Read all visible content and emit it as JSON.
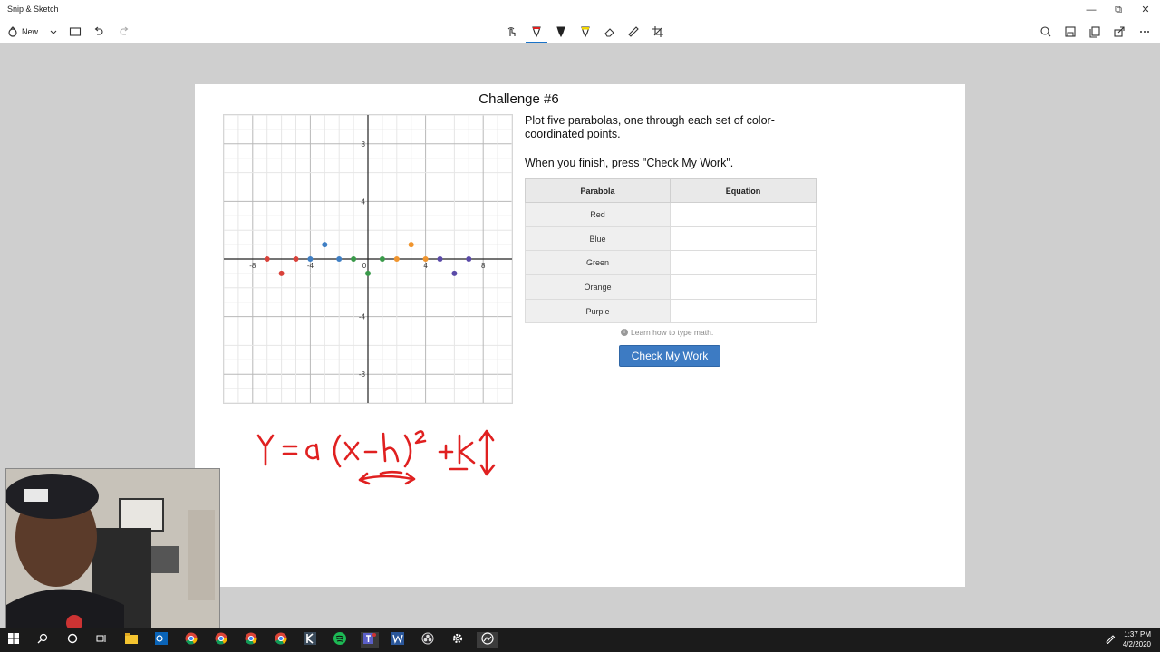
{
  "window": {
    "title": "Snip & Sketch",
    "controls": {
      "minimize": "—",
      "restore": "⧉",
      "close": "✕"
    }
  },
  "toolbar": {
    "new_label": "New",
    "left_icons": [
      "new-snip-icon",
      "chevron-down-icon",
      "open-file-icon",
      "undo-icon",
      "redo-icon"
    ],
    "center_icons": [
      "touch-writing-icon",
      "ballpoint-pen-icon",
      "pencil-icon",
      "highlighter-icon",
      "eraser-icon",
      "ruler-icon",
      "crop-icon"
    ],
    "right_icons": [
      "zoom-icon",
      "save-icon",
      "copy-icon",
      "share-icon",
      "more-icon"
    ],
    "active_tool": "ballpoint-pen-icon",
    "pen_color": "#e02020"
  },
  "challenge": {
    "title": "Challenge #6",
    "instructions": "Plot five parabolas, one through each set of color-coordinated points.",
    "finish_text": "When you finish, press \"Check My Work\".",
    "table": {
      "headers": [
        "Parabola",
        "Equation"
      ],
      "rows": [
        {
          "name": "Red",
          "equation": ""
        },
        {
          "name": "Blue",
          "equation": ""
        },
        {
          "name": "Green",
          "equation": ""
        },
        {
          "name": "Orange",
          "equation": ""
        },
        {
          "name": "Purple",
          "equation": ""
        }
      ]
    },
    "learn_link": "Learn how to type math.",
    "check_button": "Check My Work"
  },
  "graph": {
    "x_ticks": [
      "-8",
      "-4",
      "0",
      "4",
      "8"
    ],
    "y_ticks": [
      "8",
      "4",
      "-4",
      "-8"
    ],
    "points": [
      {
        "color": "red",
        "hex": "#d9423a",
        "x": -7,
        "y": 0
      },
      {
        "color": "red",
        "hex": "#d9423a",
        "x": -6,
        "y": -1
      },
      {
        "color": "red",
        "hex": "#d9423a",
        "x": -5,
        "y": 0
      },
      {
        "color": "blue",
        "hex": "#3f7fc4",
        "x": -4,
        "y": 0
      },
      {
        "color": "blue",
        "hex": "#3f7fc4",
        "x": -3,
        "y": 1
      },
      {
        "color": "blue",
        "hex": "#3f7fc4",
        "x": -2,
        "y": 0
      },
      {
        "color": "green",
        "hex": "#3a9a4a",
        "x": -1,
        "y": 0
      },
      {
        "color": "green",
        "hex": "#3a9a4a",
        "x": 0,
        "y": -1
      },
      {
        "color": "green",
        "hex": "#3a9a4a",
        "x": 1,
        "y": 0
      },
      {
        "color": "orange",
        "hex": "#f0952e",
        "x": 2,
        "y": 0
      },
      {
        "color": "orange",
        "hex": "#f0952e",
        "x": 3,
        "y": 1
      },
      {
        "color": "orange",
        "hex": "#f0952e",
        "x": 4,
        "y": 0
      },
      {
        "color": "purple",
        "hex": "#5a4aa8",
        "x": 5,
        "y": 0
      },
      {
        "color": "purple",
        "hex": "#5a4aa8",
        "x": 6,
        "y": -1
      },
      {
        "color": "purple",
        "hex": "#5a4aa8",
        "x": 7,
        "y": 0
      }
    ]
  },
  "handwriting": {
    "formula": "Y = a(x - h)^2 + k",
    "ink_color": "#e02020"
  },
  "taskbar": {
    "icons": [
      "windows-start-icon",
      "search-icon",
      "cortana-icon",
      "task-view-icon",
      "file-explorer-icon",
      "outlook-icon",
      "chrome-icon",
      "chrome-icon",
      "chrome-icon",
      "chrome-icon",
      "k-app-icon",
      "spotify-icon",
      "teams-icon",
      "word-icon",
      "obs-icon",
      "settings-icon",
      "snip-sketch-icon"
    ],
    "time": "1:37 PM",
    "date": "4/2/2020"
  }
}
